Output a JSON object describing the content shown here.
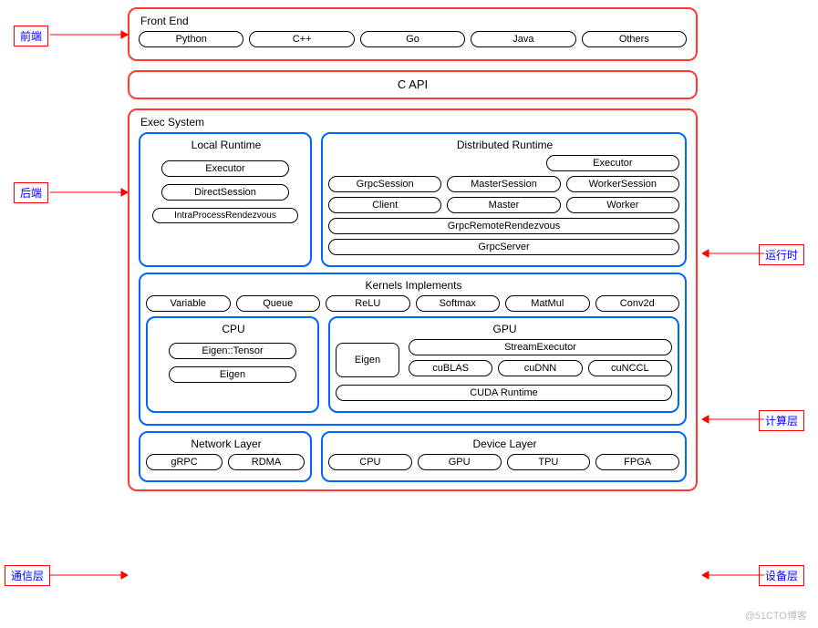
{
  "tags": {
    "frontend": "前端",
    "backend": "后端",
    "runtime": "运行时",
    "compute": "计算层",
    "comm": "通信层",
    "device": "设备层"
  },
  "frontEnd": {
    "title": "Front End",
    "langs": {
      "python": "Python",
      "cpp": "C++",
      "go": "Go",
      "java": "Java",
      "others": "Others"
    }
  },
  "capi": "C API",
  "exec": {
    "title": "Exec System",
    "local": {
      "title": "Local Runtime",
      "executor": "Executor",
      "directSession": "DirectSession",
      "intra": "IntraProcessRendezvous"
    },
    "dist": {
      "title": "Distributed Runtime",
      "executor": "Executor",
      "grpcSession": "GrpcSession",
      "masterSession": "MasterSession",
      "workerSession": "WorkerSession",
      "client": "Client",
      "master": "Master",
      "worker": "Worker",
      "grpcRemote": "GrpcRemoteRendezvous",
      "grpcServer": "GrpcServer"
    },
    "kernels": {
      "title": "Kernels Implements",
      "variable": "Variable",
      "queue": "Queue",
      "relu": "ReLU",
      "softmax": "Softmax",
      "matmul": "MatMul",
      "conv2d": "Conv2d",
      "cpu": {
        "title": "CPU",
        "eigenTensor": "Eigen::Tensor",
        "eigen": "Eigen"
      },
      "gpu": {
        "title": "GPU",
        "eigen": "Eigen",
        "stream": "StreamExecutor",
        "cublas": "cuBLAS",
        "cudnn": "cuDNN",
        "cunccl": "cuNCCL",
        "cuda": "CUDA Runtime"
      }
    },
    "net": {
      "title": "Network Layer",
      "grpc": "gRPC",
      "rdma": "RDMA"
    },
    "dev": {
      "title": "Device Layer",
      "cpu": "CPU",
      "gpu": "GPU",
      "tpu": "TPU",
      "fpga": "FPGA"
    }
  },
  "watermark": "@51CTO博客"
}
